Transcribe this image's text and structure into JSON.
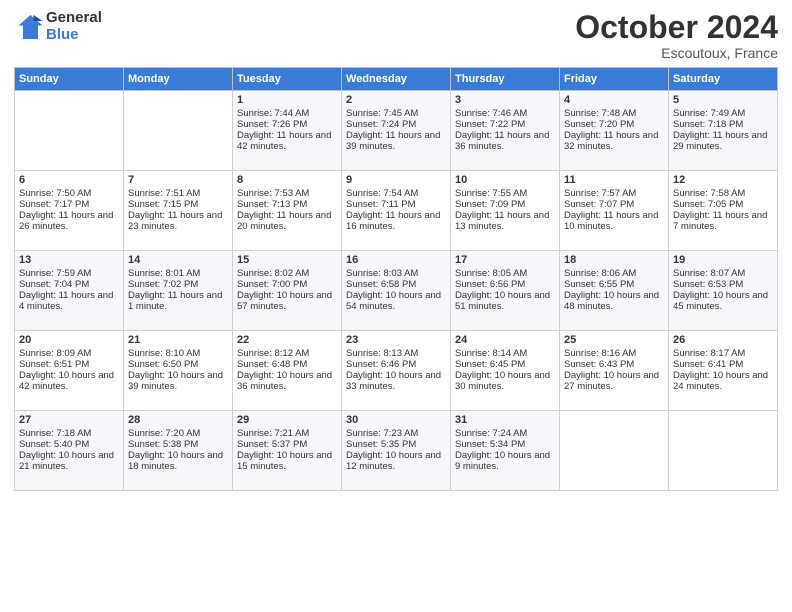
{
  "header": {
    "logo_line1": "General",
    "logo_line2": "Blue",
    "month": "October 2024",
    "location": "Escoutoux, France"
  },
  "days_of_week": [
    "Sunday",
    "Monday",
    "Tuesday",
    "Wednesday",
    "Thursday",
    "Friday",
    "Saturday"
  ],
  "weeks": [
    [
      {
        "day": null,
        "content": null
      },
      {
        "day": null,
        "content": null
      },
      {
        "day": "1",
        "content": "Sunrise: 7:44 AM\nSunset: 7:26 PM\nDaylight: 11 hours and 42 minutes."
      },
      {
        "day": "2",
        "content": "Sunrise: 7:45 AM\nSunset: 7:24 PM\nDaylight: 11 hours and 39 minutes."
      },
      {
        "day": "3",
        "content": "Sunrise: 7:46 AM\nSunset: 7:22 PM\nDaylight: 11 hours and 36 minutes."
      },
      {
        "day": "4",
        "content": "Sunrise: 7:48 AM\nSunset: 7:20 PM\nDaylight: 11 hours and 32 minutes."
      },
      {
        "day": "5",
        "content": "Sunrise: 7:49 AM\nSunset: 7:18 PM\nDaylight: 11 hours and 29 minutes."
      }
    ],
    [
      {
        "day": "6",
        "content": "Sunrise: 7:50 AM\nSunset: 7:17 PM\nDaylight: 11 hours and 26 minutes."
      },
      {
        "day": "7",
        "content": "Sunrise: 7:51 AM\nSunset: 7:15 PM\nDaylight: 11 hours and 23 minutes."
      },
      {
        "day": "8",
        "content": "Sunrise: 7:53 AM\nSunset: 7:13 PM\nDaylight: 11 hours and 20 minutes."
      },
      {
        "day": "9",
        "content": "Sunrise: 7:54 AM\nSunset: 7:11 PM\nDaylight: 11 hours and 16 minutes."
      },
      {
        "day": "10",
        "content": "Sunrise: 7:55 AM\nSunset: 7:09 PM\nDaylight: 11 hours and 13 minutes."
      },
      {
        "day": "11",
        "content": "Sunrise: 7:57 AM\nSunset: 7:07 PM\nDaylight: 11 hours and 10 minutes."
      },
      {
        "day": "12",
        "content": "Sunrise: 7:58 AM\nSunset: 7:05 PM\nDaylight: 11 hours and 7 minutes."
      }
    ],
    [
      {
        "day": "13",
        "content": "Sunrise: 7:59 AM\nSunset: 7:04 PM\nDaylight: 11 hours and 4 minutes."
      },
      {
        "day": "14",
        "content": "Sunrise: 8:01 AM\nSunset: 7:02 PM\nDaylight: 11 hours and 1 minute."
      },
      {
        "day": "15",
        "content": "Sunrise: 8:02 AM\nSunset: 7:00 PM\nDaylight: 10 hours and 57 minutes."
      },
      {
        "day": "16",
        "content": "Sunrise: 8:03 AM\nSunset: 6:58 PM\nDaylight: 10 hours and 54 minutes."
      },
      {
        "day": "17",
        "content": "Sunrise: 8:05 AM\nSunset: 6:56 PM\nDaylight: 10 hours and 51 minutes."
      },
      {
        "day": "18",
        "content": "Sunrise: 8:06 AM\nSunset: 6:55 PM\nDaylight: 10 hours and 48 minutes."
      },
      {
        "day": "19",
        "content": "Sunrise: 8:07 AM\nSunset: 6:53 PM\nDaylight: 10 hours and 45 minutes."
      }
    ],
    [
      {
        "day": "20",
        "content": "Sunrise: 8:09 AM\nSunset: 6:51 PM\nDaylight: 10 hours and 42 minutes."
      },
      {
        "day": "21",
        "content": "Sunrise: 8:10 AM\nSunset: 6:50 PM\nDaylight: 10 hours and 39 minutes."
      },
      {
        "day": "22",
        "content": "Sunrise: 8:12 AM\nSunset: 6:48 PM\nDaylight: 10 hours and 36 minutes."
      },
      {
        "day": "23",
        "content": "Sunrise: 8:13 AM\nSunset: 6:46 PM\nDaylight: 10 hours and 33 minutes."
      },
      {
        "day": "24",
        "content": "Sunrise: 8:14 AM\nSunset: 6:45 PM\nDaylight: 10 hours and 30 minutes."
      },
      {
        "day": "25",
        "content": "Sunrise: 8:16 AM\nSunset: 6:43 PM\nDaylight: 10 hours and 27 minutes."
      },
      {
        "day": "26",
        "content": "Sunrise: 8:17 AM\nSunset: 6:41 PM\nDaylight: 10 hours and 24 minutes."
      }
    ],
    [
      {
        "day": "27",
        "content": "Sunrise: 7:18 AM\nSunset: 5:40 PM\nDaylight: 10 hours and 21 minutes."
      },
      {
        "day": "28",
        "content": "Sunrise: 7:20 AM\nSunset: 5:38 PM\nDaylight: 10 hours and 18 minutes."
      },
      {
        "day": "29",
        "content": "Sunrise: 7:21 AM\nSunset: 5:37 PM\nDaylight: 10 hours and 15 minutes."
      },
      {
        "day": "30",
        "content": "Sunrise: 7:23 AM\nSunset: 5:35 PM\nDaylight: 10 hours and 12 minutes."
      },
      {
        "day": "31",
        "content": "Sunrise: 7:24 AM\nSunset: 5:34 PM\nDaylight: 10 hours and 9 minutes."
      },
      {
        "day": null,
        "content": null
      },
      {
        "day": null,
        "content": null
      }
    ]
  ]
}
